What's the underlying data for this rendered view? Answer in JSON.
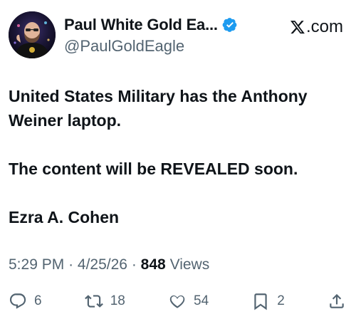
{
  "author": {
    "display_name": "Paul White Gold Ea...",
    "handle": "@PaulGoldEagle",
    "verified": true
  },
  "brand": {
    "label": ".com",
    "icon": "x-logo-icon"
  },
  "tweet": {
    "paragraphs": [
      "United States Military has the Anthony Weiner laptop.",
      "The content will be REVEALED soon.",
      "Ezra A. Cohen"
    ]
  },
  "meta": {
    "time": "5:29 PM",
    "separator": "·",
    "date": "4/25/26",
    "views_count": "848",
    "views_label": "Views"
  },
  "actions": {
    "replies": "6",
    "reposts": "18",
    "likes": "54",
    "bookmarks": "2"
  },
  "colors": {
    "text": "#0f1419",
    "secondary": "#536471",
    "verified": "#1d9bf0"
  }
}
